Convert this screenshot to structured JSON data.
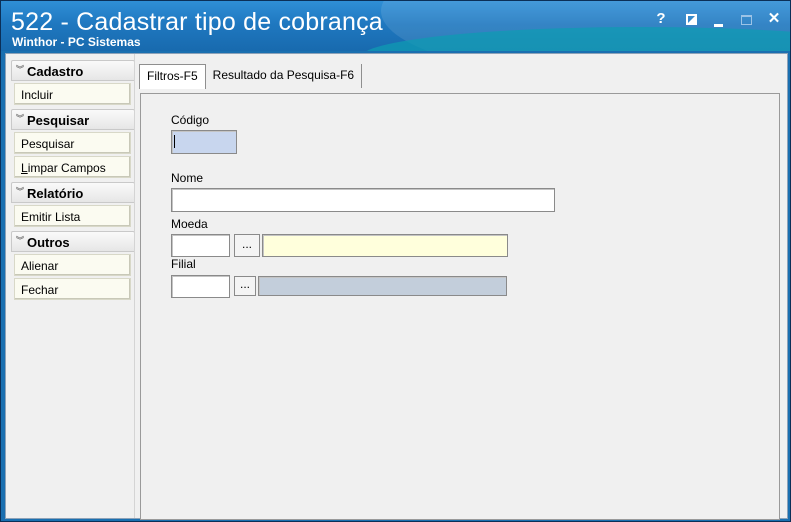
{
  "window": {
    "title": "522 - Cadastrar tipo de cobrança",
    "subtitle": "Winthor - PC Sistemas",
    "controls": {
      "help": "?",
      "close": "✕"
    }
  },
  "sidebar": {
    "groups": [
      {
        "title": "Cadastro",
        "chevron": "︾",
        "items": [
          {
            "label": "Incluir"
          }
        ]
      },
      {
        "title": "Pesquisar",
        "chevron": "︾",
        "items": [
          {
            "label": "Pesquisar"
          },
          {
            "label_underlined": "L",
            "label_rest": "impar Campos"
          }
        ]
      },
      {
        "title": "Relatório",
        "chevron": "︾",
        "items": [
          {
            "label": "Emitir Lista"
          }
        ]
      },
      {
        "title": "Outros",
        "chevron": "︾",
        "items": [
          {
            "label": "Alienar"
          },
          {
            "label": "Fechar"
          }
        ]
      }
    ]
  },
  "tabs": [
    {
      "label": "Filtros-F5",
      "active": true
    },
    {
      "label": "Resultado da Pesquisa-F6",
      "active": false
    }
  ],
  "form": {
    "codigo": {
      "label": "Código",
      "value": ""
    },
    "nome": {
      "label": "Nome",
      "value": ""
    },
    "moeda": {
      "label": "Moeda",
      "code": "",
      "lookup": "...",
      "description": ""
    },
    "filial": {
      "label": "Filial",
      "code": "",
      "lookup": "...",
      "description": ""
    }
  },
  "colors": {
    "titlebar": "#1f78c0",
    "code_field_focus": "#c8d6ee",
    "moeda_description_bg": "#ffffdc",
    "filial_description_bg": "#c3cedb"
  }
}
